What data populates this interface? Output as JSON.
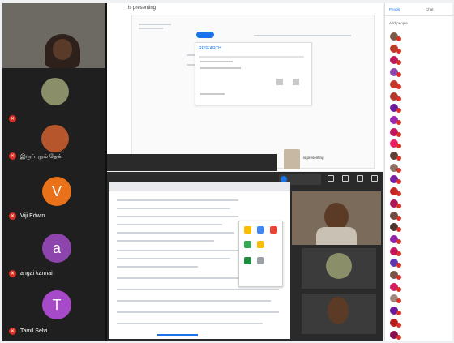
{
  "presentation": {
    "title": "is presenting",
    "card_heading": "RESEARCH",
    "presenter_text": "is presenting"
  },
  "left_column": {
    "top_tile_name": "",
    "tiles": [
      {
        "label": "",
        "type": "photo",
        "color": "#8a8f6a"
      },
      {
        "label": "இருப்புநம் தேன்",
        "type": "photo",
        "color": "#b5562d"
      },
      {
        "label": "Viji Edwin",
        "type": "avatar",
        "letter": "V",
        "color": "#e8711a"
      },
      {
        "label": "angai kannai",
        "type": "avatar",
        "letter": "a",
        "color": "#8e44ad"
      },
      {
        "label": "Tamil Selvi",
        "type": "avatar",
        "letter": "T",
        "color": "#a64ac9"
      }
    ]
  },
  "shared_screen": {
    "attendees_line1": "",
    "attendees_line2": ""
  },
  "participants_panel": {
    "tab_people": "People",
    "tab_chat": "Chat",
    "add_people_label": "Add people",
    "rows": [
      {
        "name": "",
        "color": "#7d5a48"
      },
      {
        "name": "",
        "color": "#c0392b"
      },
      {
        "name": "",
        "color": "#c2185b"
      },
      {
        "name": "",
        "color": "#8e44ad"
      },
      {
        "name": "",
        "color": "#c0392b"
      },
      {
        "name": "",
        "color": "#b03a2e"
      },
      {
        "name": "",
        "color": "#6a1b9a"
      },
      {
        "name": "",
        "color": "#9c27b0"
      },
      {
        "name": "",
        "color": "#c2185b"
      },
      {
        "name": "",
        "color": "#e91e63"
      },
      {
        "name": "",
        "color": "#5d4037"
      },
      {
        "name": "",
        "color": "#8d6e63"
      },
      {
        "name": "",
        "color": "#7b1fa2"
      },
      {
        "name": "",
        "color": "#c62828"
      },
      {
        "name": "",
        "color": "#ad1457"
      },
      {
        "name": "",
        "color": "#6d4c41"
      },
      {
        "name": "",
        "color": "#4e342e"
      },
      {
        "name": "",
        "color": "#8e24aa"
      },
      {
        "name": "",
        "color": "#c2185b"
      },
      {
        "name": "",
        "color": "#5e35b1"
      },
      {
        "name": "",
        "color": "#795548"
      },
      {
        "name": "",
        "color": "#d81b60"
      },
      {
        "name": "",
        "color": "#a1887f"
      },
      {
        "name": "",
        "color": "#6a1b9a"
      },
      {
        "name": "",
        "color": "#b71c1c"
      },
      {
        "name": "",
        "color": "#880e4f"
      }
    ]
  },
  "colors": {
    "accent": "#1a73e8",
    "mic_off": "#d93025"
  }
}
